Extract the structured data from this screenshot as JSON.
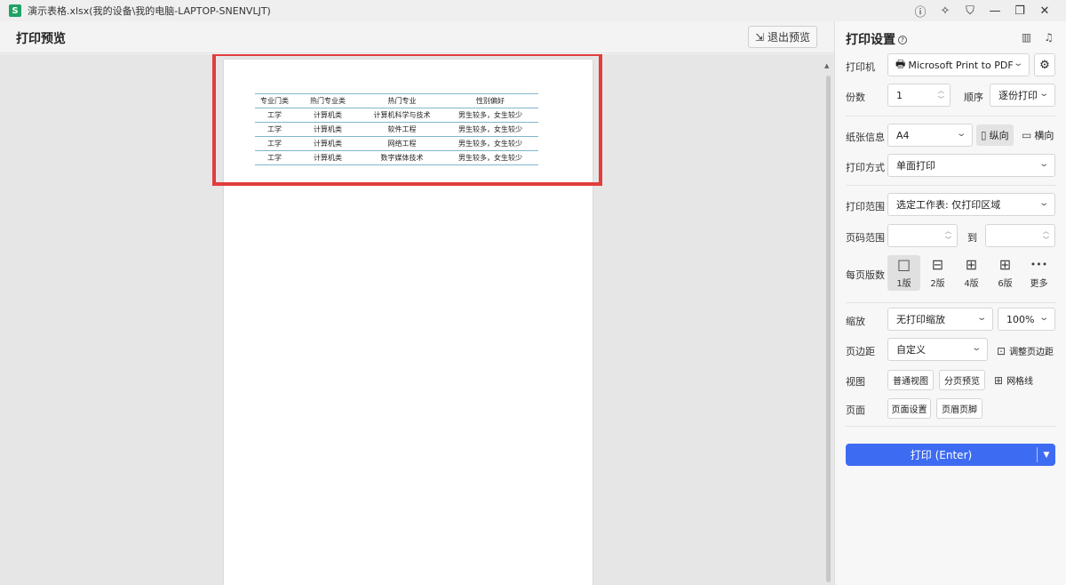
{
  "window": {
    "app_icon_letter": "S",
    "title": "演示表格.xlsx(我的设备\\我的电脑-LAPTOP-SNENVLJT)",
    "controls": [
      "ⓘ",
      "✧",
      "⛉",
      "—",
      "❐",
      "✕"
    ]
  },
  "preview": {
    "title": "打印预览",
    "exit_label": "退出预览",
    "table": {
      "headers": [
        "专业门类",
        "热门专业类",
        "热门专业",
        "性别偏好"
      ],
      "rows": [
        [
          "工学",
          "计算机类",
          "计算机科学与技术",
          "男生较多，女生较少"
        ],
        [
          "工学",
          "计算机类",
          "软件工程",
          "男生较多，女生较少"
        ],
        [
          "工学",
          "计算机类",
          "网络工程",
          "男生较多，女生较少"
        ],
        [
          "工学",
          "计算机类",
          "数字媒体技术",
          "男生较多，女生较少"
        ]
      ]
    }
  },
  "settings": {
    "title": "打印设置",
    "printer_label": "打印机",
    "printer_value": "Microsoft Print to PDF",
    "copies_label": "份数",
    "copies_value": "1",
    "order_label": "顺序",
    "order_value": "逐份打印",
    "paper_label": "纸张信息",
    "paper_value": "A4",
    "portrait_label": "纵向",
    "landscape_label": "横向",
    "mode_label": "打印方式",
    "mode_value": "单面打印",
    "range_label": "打印范围",
    "range_value": "选定工作表: 仅打印区域",
    "page_range_label": "页码范围",
    "page_range_to": "到",
    "per_page_label": "每页版数",
    "layouts": [
      {
        "label": "1版",
        "icon": "□"
      },
      {
        "label": "2版",
        "icon": "⊟"
      },
      {
        "label": "4版",
        "icon": "⊞"
      },
      {
        "label": "6版",
        "icon": "⊞"
      },
      {
        "label": "更多",
        "icon": "•••"
      }
    ],
    "scale_label": "缩放",
    "scale_value": "无打印缩放",
    "zoom_value": "100%",
    "margin_label": "页边距",
    "margin_value": "自定义",
    "adjust_margin_label": "调整页边距",
    "view_label": "视图",
    "normal_view_label": "普通视图",
    "page_break_label": "分页预览",
    "gridlines_label": "网格线",
    "page_label": "页面",
    "page_setup_label": "页面设置",
    "header_footer_label": "页眉页脚",
    "print_button_label": "打印 (Enter)"
  },
  "colors": {
    "accent": "#3d6bf2",
    "highlight": "#e23c3c",
    "table_rule": "#7fb7cf"
  }
}
